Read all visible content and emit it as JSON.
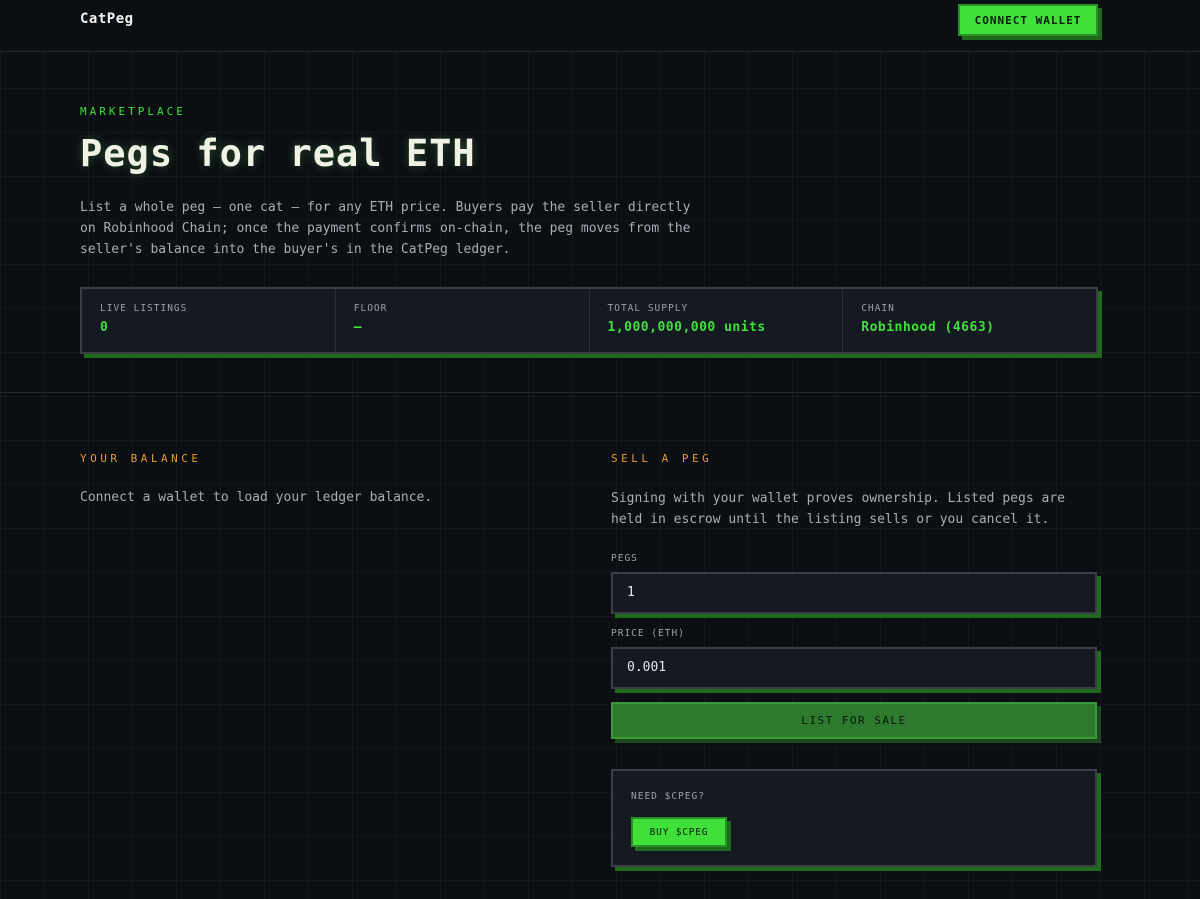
{
  "nav": {
    "brand": "CatPeg",
    "connect_label": "CONNECT WALLET"
  },
  "hero": {
    "eyebrow": "MARKETPLACE",
    "title": "Pegs for real ETH",
    "description": "List a whole peg — one cat — for any ETH price. Buyers pay the seller directly on Robinhood Chain; once the payment confirms on-chain, the peg moves from the seller's balance into the buyer's in the CatPeg ledger."
  },
  "stats": [
    {
      "label": "LIVE LISTINGS",
      "value": "0"
    },
    {
      "label": "FLOOR",
      "value": "—"
    },
    {
      "label": "TOTAL SUPPLY",
      "value": "1,000,000,000 units"
    },
    {
      "label": "CHAIN",
      "value": "Robinhood (4663)"
    }
  ],
  "balance": {
    "eyebrow": "YOUR BALANCE",
    "text": "Connect a wallet to load your ledger balance."
  },
  "sell": {
    "eyebrow": "SELL A PEG",
    "text": "Signing with your wallet proves ownership. Listed pegs are held in escrow until the listing sells or you cancel it.",
    "pegs_label": "PEGS",
    "pegs_value": "1",
    "price_label": "PRICE (ETH)",
    "price_value": "0.001",
    "submit_label": "LIST FOR SALE"
  },
  "need": {
    "label": "NEED $CPEG?",
    "button_label": "BUY $CPEG"
  },
  "colors": {
    "accent_green": "#3fe03a",
    "accent_orange": "#e89a2c",
    "background": "#0b0e13"
  }
}
